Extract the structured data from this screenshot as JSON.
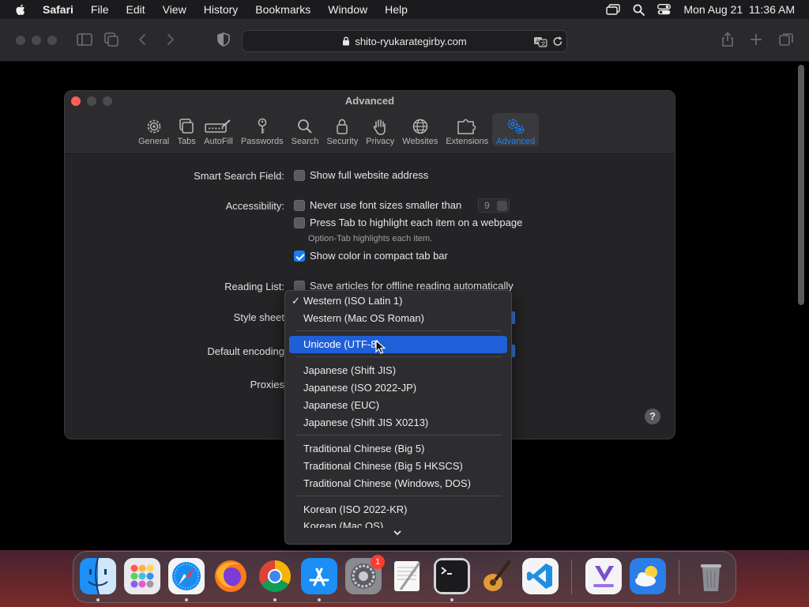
{
  "menubar": {
    "app": "Safari",
    "items": [
      "File",
      "Edit",
      "View",
      "History",
      "Bookmarks",
      "Window",
      "Help"
    ],
    "clock": "Mon Aug 21  11:36 AM"
  },
  "browser": {
    "url": "shito-ryukarategirby.com"
  },
  "prefs": {
    "title": "Advanced",
    "tabs": [
      "General",
      "Tabs",
      "AutoFill",
      "Passwords",
      "Search",
      "Security",
      "Privacy",
      "Websites",
      "Extensions",
      "Advanced"
    ],
    "active_tab": "Advanced",
    "smart_search_label": "Smart Search Field:",
    "show_full_address": "Show full website address",
    "accessibility_label": "Accessibility:",
    "never_font_smaller": "Never use font sizes smaller than",
    "min_font_size": "9",
    "press_tab": "Press Tab to highlight each item on a webpage",
    "option_tab_hint": "Option-Tab highlights each item.",
    "show_color_tab_bar": "Show color in compact tab bar",
    "reading_list_label": "Reading List:",
    "reading_list_text": "Save articles for offline reading automatically",
    "style_sheet_label": "Style sheet",
    "default_encoding_label": "Default encoding",
    "proxies_label": "Proxies",
    "help": "?"
  },
  "encoding_menu": {
    "checked": "Western (ISO Latin 1)",
    "highlighted": "Unicode (UTF-8)",
    "items": [
      "Western (ISO Latin 1)",
      "Western (Mac OS Roman)",
      "Unicode (UTF-8)",
      "Japanese (Shift JIS)",
      "Japanese (ISO 2022-JP)",
      "Japanese (EUC)",
      "Japanese (Shift JIS X0213)",
      "Traditional Chinese (Big 5)",
      "Traditional Chinese (Big 5 HKSCS)",
      "Traditional Chinese (Windows, DOS)",
      "Korean (ISO 2022-KR)",
      "Korean (Mac OS)"
    ]
  },
  "dock": {
    "apps": [
      "finder-icon",
      "launchpad-icon",
      "safari-icon",
      "firefox-icon",
      "chrome-icon",
      "app-store-icon",
      "system-settings-icon",
      "textedit-icon",
      "terminal-icon",
      "garageband-icon",
      "vscode-icon",
      "visual-studio-icon",
      "weather-icon",
      "trash-icon"
    ],
    "settings_badge": "1"
  },
  "colors": {
    "accent": "#1a84ff",
    "menu_highlight": "#1f5fd8",
    "close": "#ff5f57"
  }
}
